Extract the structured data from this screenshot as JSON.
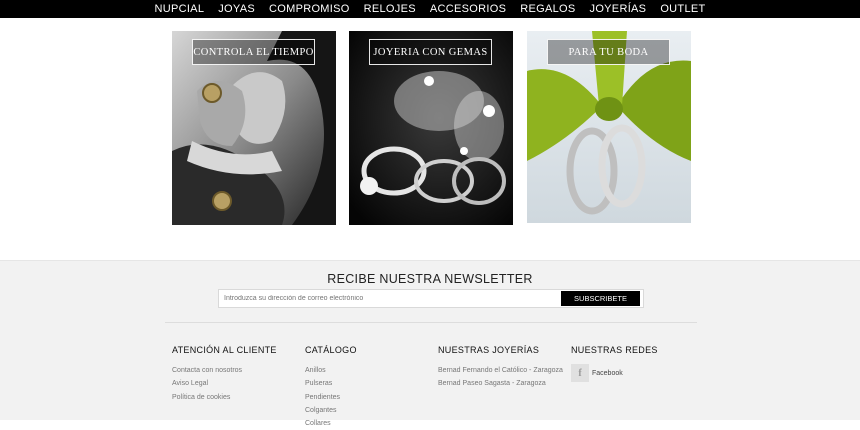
{
  "nav": {
    "items": [
      "NUPCIAL",
      "JOYAS",
      "COMPROMISO",
      "RELOJES",
      "ACCESORIOS",
      "REGALOS",
      "JOYERÍAS",
      "OUTLET"
    ]
  },
  "banners": [
    {
      "label": "CONTROLA EL TIEMPO"
    },
    {
      "label": "JOYERIA CON GEMAS"
    },
    {
      "label": "PARA TU BODA"
    }
  ],
  "newsletter": {
    "title": "RECIBE NUESTRA NEWSLETTER",
    "placeholder": "Introduzca su dirección de correo electrónico",
    "button": "SUBSCRIBETE"
  },
  "footer": {
    "customer": {
      "title": "ATENCIÓN AL CLIENTE",
      "links": [
        "Contacta con nosotros",
        "Aviso Legal",
        "Política de cookies"
      ]
    },
    "catalog": {
      "title": "CATÁLOGO",
      "links": [
        "Anillos",
        "Pulseras",
        "Pendientes",
        "Colgantes",
        "Collares"
      ]
    },
    "stores": {
      "title": "NUESTRAS JOYERÍAS",
      "links": [
        "Bernad Fernando el Católico - Zaragoza",
        "Bernad Paseo Sagasta - Zaragoza"
      ]
    },
    "social": {
      "title": "NUESTRAS REDES",
      "facebook_label": "Facebook",
      "facebook_glyph": "f"
    }
  },
  "colors": {
    "nav_bg": "#000000",
    "footer_bg": "#f2f2f2",
    "ribbon_green": "#8fb31f"
  }
}
